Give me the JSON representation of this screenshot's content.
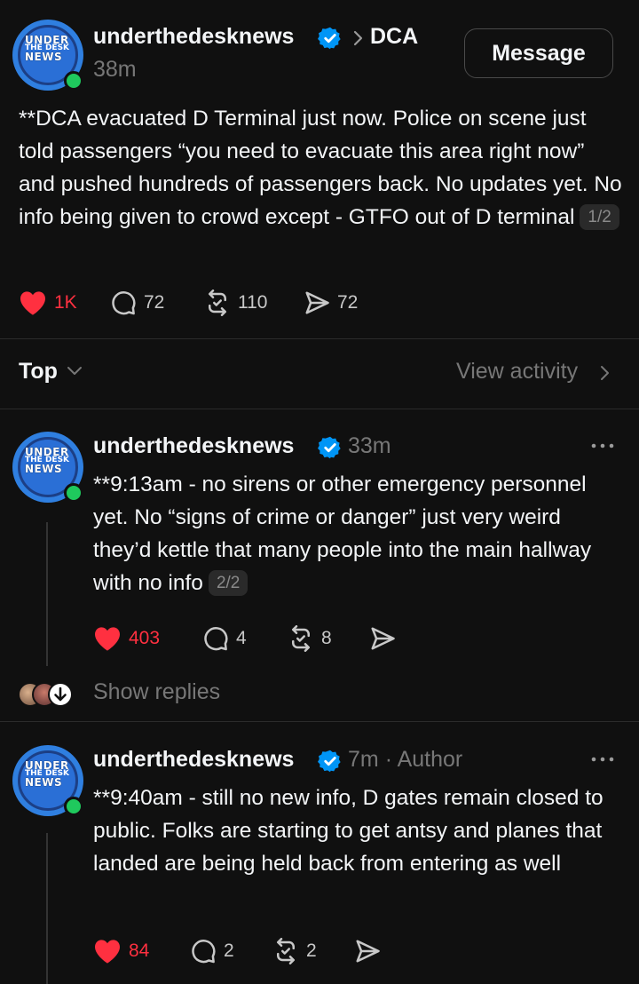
{
  "original_post": {
    "avatar_text": [
      "UNDER",
      "THE DESK",
      "NEWS"
    ],
    "username": "underthedesknews",
    "breadcrumb_separator": ">",
    "community": "DCA",
    "time": "38m",
    "message_button": "Message",
    "text": "**DCA evacuated D Terminal just now. Police on scene just told passengers “you need to evacuate this area right now” and pushed hundreds of passengers back. No updates yet. No info being given to crowd except - GTFO out of D terminal",
    "thread_index": "1/2",
    "likes": "1K",
    "replies": "72",
    "reposts": "110",
    "shares": "72"
  },
  "sort_bar": {
    "label": "Top",
    "view_activity": "View activity"
  },
  "replies": [
    {
      "username": "underthedesknews",
      "time": "33m",
      "author_tag": "",
      "text": "**9:13am - no sirens or other emergency personnel yet. No “signs of crime or danger” just very weird they’d kettle that many people into the main hallway with no info",
      "thread_index": "2/2",
      "likes": "403",
      "replies": "4",
      "reposts": "8",
      "shares": ""
    },
    {
      "username": "underthedesknews",
      "time": "7m",
      "author_tag": "· Author",
      "text": "**9:40am - still no new info, D gates remain closed to public. Folks are starting to get antsy and planes that landed are being held back from entering as well",
      "thread_index": "",
      "likes": "84",
      "replies": "2",
      "reposts": "2",
      "shares": ""
    }
  ],
  "show_replies": "Show replies",
  "icons": {
    "like": "heart-icon",
    "reply": "comment-icon",
    "repost": "repost-icon",
    "share": "send-icon",
    "verified": "verified-badge-icon",
    "more": "more-options-icon"
  },
  "colors": {
    "background": "#101010",
    "like": "#ff3040",
    "verified": "#0095f6",
    "online": "#1fc95d",
    "muted": "#777777"
  }
}
